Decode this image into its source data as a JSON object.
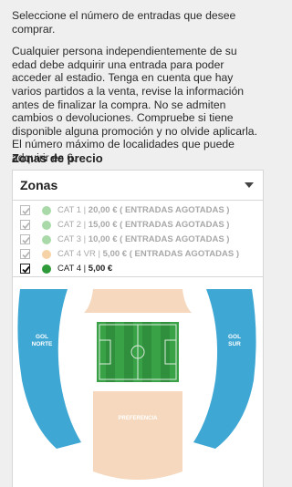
{
  "intro": {
    "line1": "Seleccione el número de entradas que desee comprar.",
    "line2": "Cualquier persona independientemente de su edad debe adquirir una entrada para poder acceder al estadio. Tenga en cuenta que hay varios partidos a la venta, revise la información antes de finalizar la compra. No se admiten cambios o devoluciones. Compruebe si tiene disponible alguna promoción y no olvide aplicarla. El número máximo de localidades que puede adquirir es 6."
  },
  "zones": {
    "title": "Zonas de precio",
    "select_label": "Zonas",
    "options": [
      {
        "name": "CAT 1",
        "price": "20,00 €",
        "status": "( ENTRADAS AGOTADAS )",
        "color": "#a9d9a9",
        "checked": true,
        "available": false
      },
      {
        "name": "CAT 2",
        "price": "15,00 €",
        "status": "( ENTRADAS AGOTADAS )",
        "color": "#a9d9a9",
        "checked": true,
        "available": false
      },
      {
        "name": "CAT 3",
        "price": "10,00 €",
        "status": "( ENTRADAS AGOTADAS )",
        "color": "#a9d9a9",
        "checked": true,
        "available": false
      },
      {
        "name": "CAT 4 VR",
        "price": "5,00 €",
        "status": "( ENTRADAS AGOTADAS )",
        "color": "#f6d3a6",
        "checked": true,
        "available": false
      },
      {
        "name": "CAT 4",
        "price": "5,00 €",
        "status": "",
        "color": "#2e9a3a",
        "checked": true,
        "available": true
      }
    ]
  },
  "stadium": {
    "gol_norte": [
      "GOL",
      "NORTE"
    ],
    "gol_sur": [
      "GOL",
      "SUR"
    ],
    "preferencia": "PREFERENCIA",
    "colors": {
      "gol": "#3ea7d3",
      "tribuna": "#f5d8bd",
      "pitch_dark": "#2f8f3c",
      "pitch_light": "#39a146"
    }
  }
}
